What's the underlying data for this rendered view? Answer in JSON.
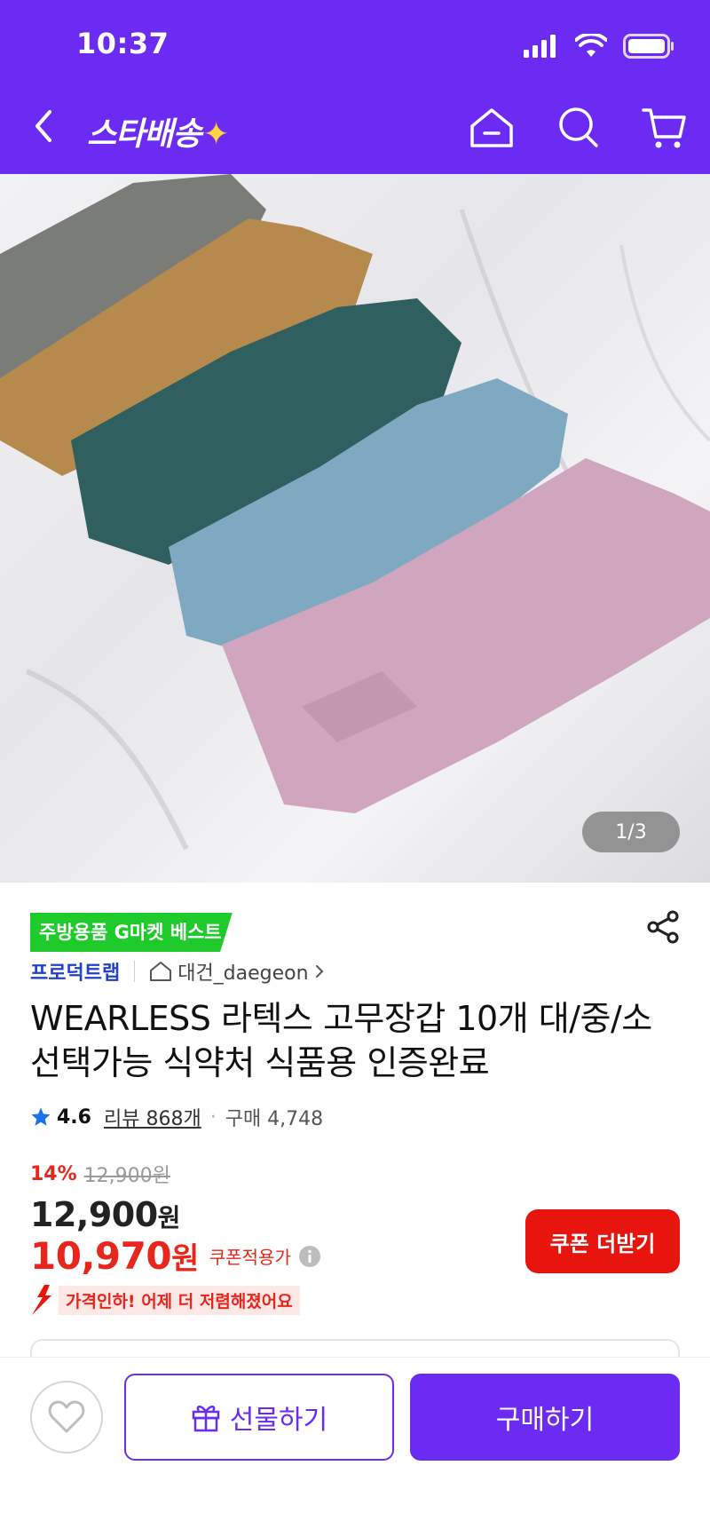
{
  "status_bar": {
    "time": "10:37"
  },
  "nav": {
    "logo": "스타배송",
    "logo_spark": "✦"
  },
  "colors": {
    "brand_purple": "#6c2bf2",
    "sale_red": "#e8261c",
    "best_green": "#1fcb2a"
  },
  "gallery": {
    "page_indicator": "1/3"
  },
  "product": {
    "badge": "주방용품 G마켓 베스트",
    "brand": "프로덕트랩",
    "shop": "대건_daegeon",
    "title": "WEARLESS 라텍스 고무장갑 10개 대/중/소 선택가능 식약처 식품용 인증완료",
    "rating": "4.6",
    "review": "리뷰 868개",
    "purchases": "구매 4,748"
  },
  "price": {
    "discount_pct": "14%",
    "original": "12,900원",
    "sale_amount": "12,900",
    "sale_unit": "원",
    "coupon_amount": "10,970",
    "coupon_unit": "원",
    "coupon_note": "쿠폰적용가",
    "drop_notice": "가격인하! 어제 더 저렴해졌어요",
    "coupon_button": "쿠폰 더받기"
  },
  "bottom": {
    "gift_label": "선물하기",
    "buy_label": "구매하기"
  }
}
